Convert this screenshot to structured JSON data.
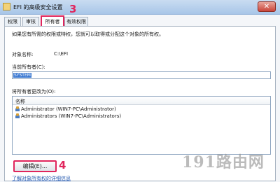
{
  "window": {
    "title": "EFI 的高级安全设置",
    "close_glyph": "✕"
  },
  "tabs": [
    {
      "label": "权限",
      "active": false
    },
    {
      "label": "审核",
      "active": false
    },
    {
      "label": "所有者",
      "active": true
    },
    {
      "label": "有效权限",
      "active": false
    }
  ],
  "annotations": {
    "step_tab": "3",
    "step_button": "4"
  },
  "owner_panel": {
    "description": "如果您有所需的权限或特权，您就可以取得或分配这个对象的所有权。",
    "object_name_label": "对象名称:",
    "object_name_value": "C:\\EFI",
    "current_owner_label": "当前所有者(C):",
    "current_owner_value": "SYSTEM",
    "change_owner_label": "将所有者更改为(O):",
    "list_header": "名称",
    "list_items": [
      {
        "name": "Administrator (WIN7-PC\\Administrator)"
      },
      {
        "name": "Administrators (WIN7-PC\\Administrators)"
      }
    ],
    "edit_button": "编辑(E)...",
    "partial_link": "了解对象所有权的详细信息"
  },
  "watermark": "191路由网",
  "colors": {
    "annotation": "#e0255c",
    "selection": "#3a78d1"
  }
}
